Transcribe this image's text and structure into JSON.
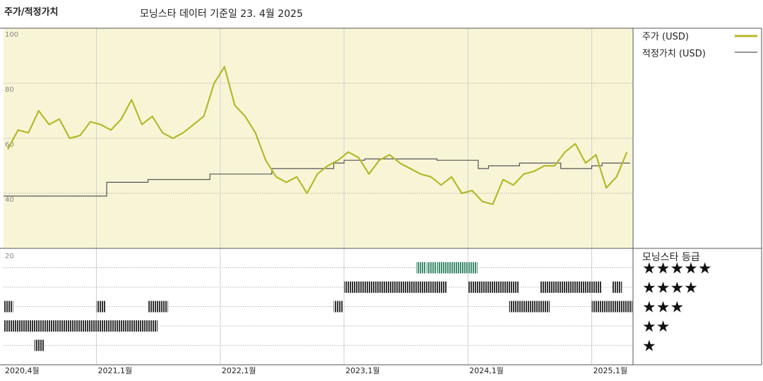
{
  "header": {
    "title": "주가/적정가치",
    "source": "모닝스타 데이터 기준일 23. 4월 2025"
  },
  "colors": {
    "price": "#b5b82a",
    "fair_value": "#555555",
    "panel_bg": "#f8f5d7",
    "grid": "#777777",
    "bar_dark": "#333333",
    "bar_green": "#3d8a6b"
  },
  "chart_data": [
    {
      "type": "line",
      "ylim": [
        20,
        100
      ],
      "yticks": [
        "100",
        "80",
        "60",
        "40"
      ],
      "ytick_values": [
        100,
        80,
        60,
        40
      ],
      "xlim": [
        "2020-04",
        "2025-05"
      ],
      "xticks": [
        "2020,4월",
        "2021,1월",
        "2022,1월",
        "2023,1월",
        "2024,1월",
        "2025,1월"
      ],
      "xtick_dates": [
        "2020-04",
        "2021-01",
        "2022-01",
        "2023-01",
        "2024-01",
        "2025-01"
      ],
      "legend_position": "right",
      "series": [
        {
          "name": "주가 (USD)",
          "x": [
            "2020-04",
            "2020-05",
            "2020-06",
            "2020-07",
            "2020-08",
            "2020-09",
            "2020-10",
            "2020-11",
            "2020-12",
            "2021-01",
            "2021-02",
            "2021-03",
            "2021-04",
            "2021-05",
            "2021-06",
            "2021-07",
            "2021-08",
            "2021-09",
            "2021-10",
            "2021-11",
            "2021-12",
            "2022-01",
            "2022-02",
            "2022-03",
            "2022-04",
            "2022-05",
            "2022-06",
            "2022-07",
            "2022-08",
            "2022-09",
            "2022-10",
            "2022-11",
            "2022-12",
            "2023-01",
            "2023-02",
            "2023-03",
            "2023-04",
            "2023-05",
            "2023-06",
            "2023-07",
            "2023-08",
            "2023-09",
            "2023-10",
            "2023-11",
            "2023-12",
            "2024-01",
            "2024-02",
            "2024-03",
            "2024-04",
            "2024-05",
            "2024-06",
            "2024-07",
            "2024-08",
            "2024-09",
            "2024-10",
            "2024-11",
            "2024-12",
            "2025-01",
            "2025-02",
            "2025-03",
            "2025-04"
          ],
          "values": [
            56,
            63,
            62,
            70,
            65,
            67,
            60,
            61,
            66,
            65,
            63,
            67,
            74,
            65,
            68,
            62,
            60,
            62,
            65,
            68,
            80,
            86,
            72,
            68,
            62,
            52,
            46,
            44,
            46,
            40,
            47,
            50,
            52,
            55,
            53,
            47,
            52,
            54,
            51,
            49,
            47,
            46,
            43,
            46,
            40,
            41,
            37,
            36,
            45,
            43,
            47,
            48,
            50,
            50,
            55,
            58,
            51,
            54,
            42,
            46,
            55
          ]
        },
        {
          "name": "적정가치 (USD)",
          "x": [
            "2020-04",
            "2021-01",
            "2021-02",
            "2021-06",
            "2021-12",
            "2022-06",
            "2022-12",
            "2023-01",
            "2023-03",
            "2023-05",
            "2023-09",
            "2023-10",
            "2024-01",
            "2024-02",
            "2024-03",
            "2024-05",
            "2024-06",
            "2024-09",
            "2024-10",
            "2025-01",
            "2025-02",
            "2025-04"
          ],
          "values": [
            39,
            39,
            44,
            45,
            47,
            49,
            51,
            52,
            52.5,
            52.5,
            52.5,
            52,
            52,
            49,
            50,
            50,
            51,
            51,
            49,
            50,
            51,
            51
          ]
        }
      ]
    },
    {
      "type": "timeline",
      "legend_title": "모닝스타 등급",
      "star_levels": [
        "★★★★★",
        "★★★★",
        "★★★",
        "★★",
        "★"
      ],
      "star_values": [
        5,
        4,
        3,
        2,
        1
      ],
      "periods": [
        {
          "rating": 3,
          "from": "2020-04",
          "to": "2020-04"
        },
        {
          "rating": 2,
          "from": "2020-04",
          "to": "2020-07"
        },
        {
          "rating": 1,
          "from": "2020-07",
          "to": "2020-07"
        },
        {
          "rating": 2,
          "from": "2020-07",
          "to": "2021-01"
        },
        {
          "rating": 3,
          "from": "2021-01",
          "to": "2021-01"
        },
        {
          "rating": 2,
          "from": "2021-01",
          "to": "2021-06"
        },
        {
          "rating": 3,
          "from": "2021-06",
          "to": "2021-07"
        },
        {
          "rating": 3,
          "from": "2022-12",
          "to": "2022-12"
        },
        {
          "rating": 4,
          "from": "2023-01",
          "to": "2023-08"
        },
        {
          "rating": 5,
          "from": "2023-08",
          "to": "2023-08"
        },
        {
          "rating": 4,
          "from": "2023-08",
          "to": "2023-09"
        },
        {
          "rating": 5,
          "from": "2023-09",
          "to": "2023-09"
        },
        {
          "rating": 4,
          "from": "2023-09",
          "to": "2023-10"
        },
        {
          "rating": 5,
          "from": "2023-10",
          "to": "2024-01"
        },
        {
          "rating": 4,
          "from": "2024-01",
          "to": "2024-05"
        },
        {
          "rating": 3,
          "from": "2024-05",
          "to": "2024-08"
        },
        {
          "rating": 4,
          "from": "2024-08",
          "to": "2025-01"
        },
        {
          "rating": 3,
          "from": "2025-01",
          "to": "2025-03"
        },
        {
          "rating": 4,
          "from": "2025-03",
          "to": "2025-03"
        },
        {
          "rating": 3,
          "from": "2025-03",
          "to": "2025-04"
        }
      ]
    }
  ],
  "timeline_ytick": "20"
}
